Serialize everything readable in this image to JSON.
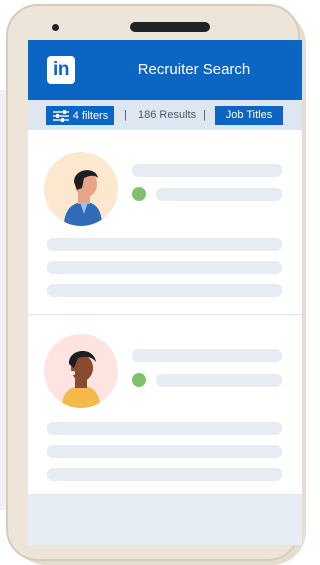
{
  "header": {
    "logo_text": "in",
    "title": "Recruiter Search"
  },
  "filterbar": {
    "filters_label": "4 filters",
    "separator": "|",
    "results_label": "186 Results",
    "job_titles_label": "Job Titles"
  },
  "candidates": [
    {
      "status": "online",
      "status_color": "#7ec36b",
      "avatar_bg": "#fbe8cf"
    },
    {
      "status": "online",
      "status_color": "#7ec36b",
      "avatar_bg": "#fde4e0"
    }
  ],
  "colors": {
    "brand": "#0a66c2",
    "filter_bar": "#dde6f1",
    "placeholder": "#e7ecf2"
  }
}
